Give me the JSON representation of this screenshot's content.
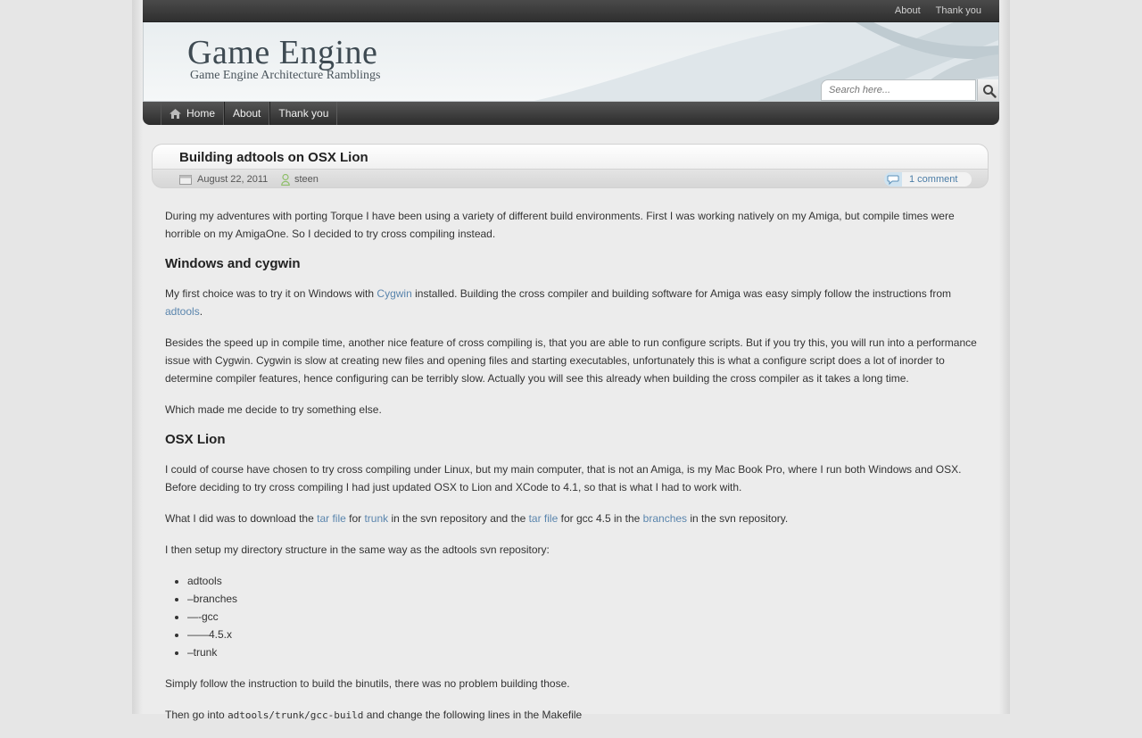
{
  "topnav": {
    "items": [
      "About",
      "Thank you"
    ]
  },
  "site": {
    "title": "Game Engine",
    "tagline": "Game Engine Architecture Ramblings"
  },
  "search": {
    "placeholder": "Search here..."
  },
  "mainnav": {
    "items": [
      "Home",
      "About",
      "Thank you"
    ]
  },
  "post": {
    "title": "Building adtools on OSX Lion",
    "date": "August 22, 2011",
    "author": "steen",
    "comments": "1 comment"
  },
  "content": {
    "p1": "During my adventures with porting Torque I have been using a variety of different build environments. First I was working natively on my Amiga, but compile times were horrible on my AmigaOne. So I decided to try cross compiling instead.",
    "h1": "Windows and cygwin",
    "p2_a": "My first choice was to try it on Windows with ",
    "p2_link1": "Cygwin",
    "p2_b": " installed. Building the cross compiler and building software for Amiga was easy simply follow the instructions from ",
    "p2_link2": "adtools",
    "p2_c": ".",
    "p3": "Besides the speed up in compile time, another nice feature of cross compiling is, that you are able to run configure scripts. But if you try this, you will run into a performance issue with Cygwin. Cygwin is slow at creating new files and opening files and starting executables, unfortunately this is what a configure script does a lot of inorder to determine compiler features, hence configuring can be terribly slow. Actually you will see this already when building the cross compiler as it takes a long time.",
    "p4": "Which made me decide to try something else.",
    "h2": "OSX Lion",
    "p5": "I could of course have chosen to try cross compiling under Linux, but my main computer, that is not an Amiga, is my Mac Book Pro, where I run both Windows and OSX. Before deciding to try cross compiling I had just updated OSX to Lion and XCode to 4.1, so that is what I had to work with.",
    "p6_a": "What I did was to download the ",
    "p6_link1": "tar file",
    "p6_b": " for ",
    "p6_link2": "trunk",
    "p6_c": " in the svn repository and the ",
    "p6_link3": "tar file",
    "p6_d": " for gcc 4.5 in the ",
    "p6_link4": "branches",
    "p6_e": " in the svn repository.",
    "p7": "I then setup my directory structure in the same way as the adtools svn repository:",
    "dirs": [
      "adtools",
      "–branches",
      "—-gcc",
      "——4.5.x",
      "–trunk"
    ],
    "p8": "Simply follow the instruction to build the binutils, there was no problem building those.",
    "p9_a": "Then go into ",
    "p9_code": "adtools/trunk/gcc-build",
    "p9_b": " and change the following lines in the Makefile"
  },
  "colors": {
    "link": "#5a85ad",
    "topbar": "#2f2f2f",
    "background": "#e6e6e6"
  },
  "icons": [
    "search-icon",
    "home-icon",
    "calendar-icon",
    "user-icon",
    "comment-bubble-icon"
  ]
}
